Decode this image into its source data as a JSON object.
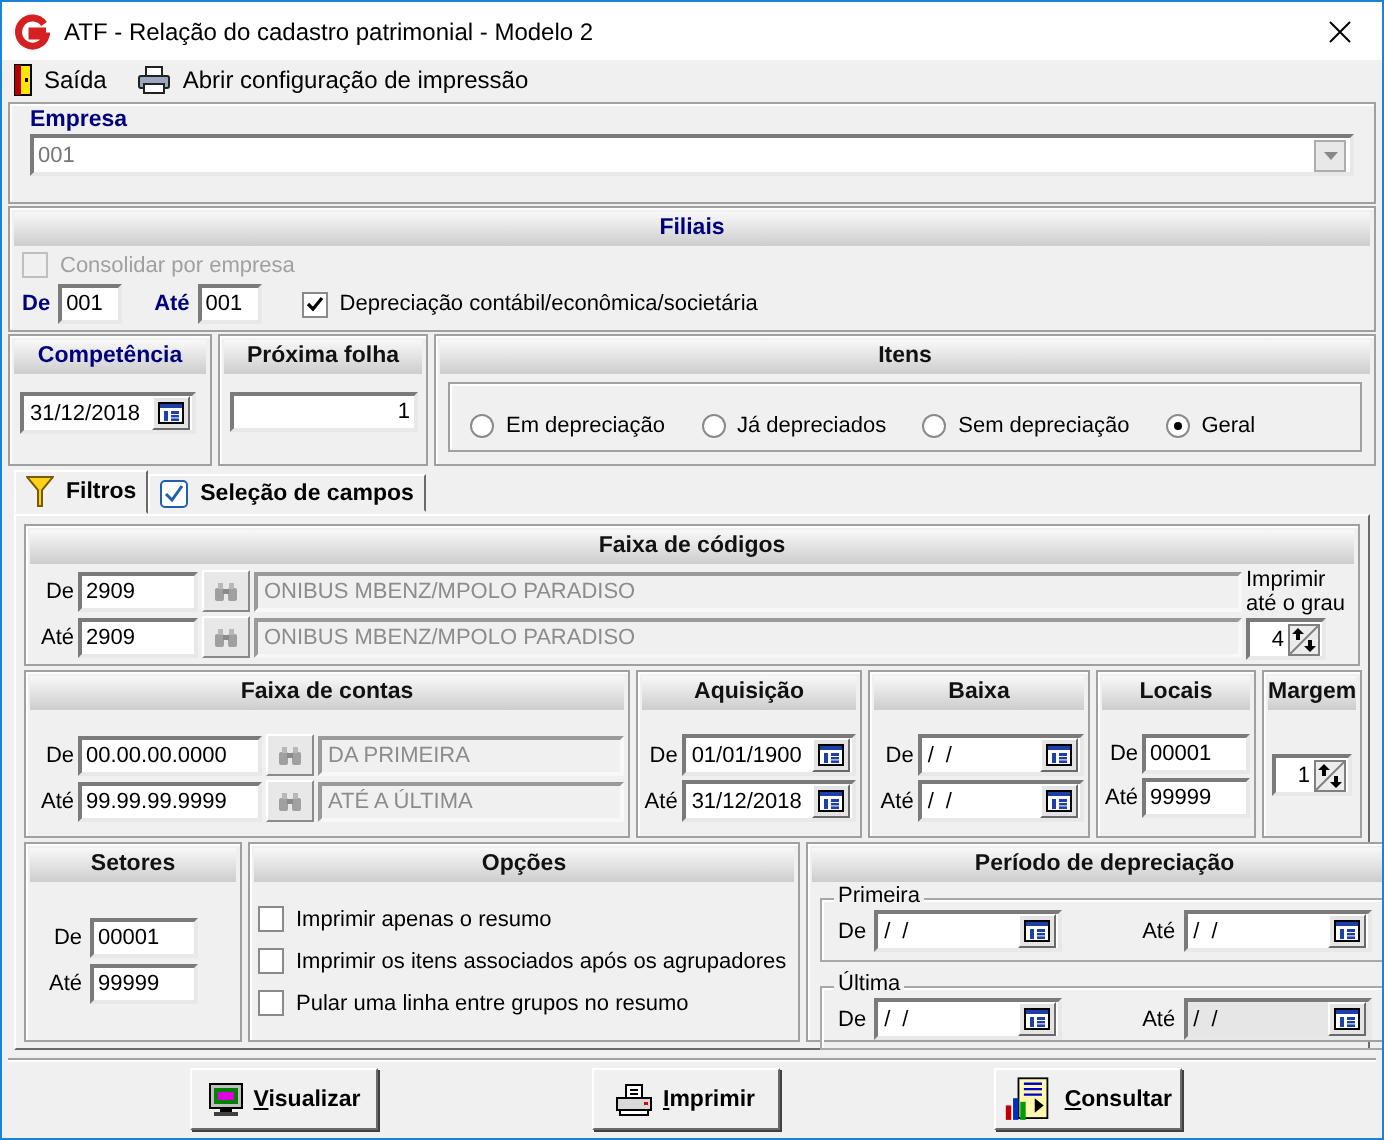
{
  "window": {
    "title": "ATF - Relação do cadastro patrimonial - Modelo 2"
  },
  "menu": [
    {
      "kind": "exit",
      "label": "Saída"
    },
    {
      "kind": "print",
      "label": "Abrir configuração de impressão"
    }
  ],
  "empresa": {
    "title": "Empresa",
    "value": "001"
  },
  "filiais": {
    "title": "Filiais",
    "accent": true,
    "consolidar": {
      "label": "Consolidar por empresa",
      "checked": false,
      "disabled": true
    },
    "de_label": "De",
    "de": "001",
    "ate_label": "Até",
    "ate": "001",
    "depreciacao": {
      "label": "Depreciação contábil/econômica/societária",
      "checked": true,
      "disabled": false
    }
  },
  "competencia": {
    "title": "Competência",
    "accent": true,
    "value": "31/12/2018"
  },
  "proxima_folha": {
    "title": "Próxima folha",
    "accent": false,
    "value": "1"
  },
  "itens": {
    "title": "Itens",
    "accent": false,
    "options": [
      {
        "label": "Em depreciação",
        "selected": false
      },
      {
        "label": "Já depreciados",
        "selected": false
      },
      {
        "label": "Sem depreciação",
        "selected": false
      },
      {
        "label": "Geral",
        "selected": true
      }
    ]
  },
  "tabs": [
    {
      "kind": "filter",
      "label": "Filtros",
      "selected": true
    },
    {
      "kind": "check",
      "label": "Seleção de campos",
      "selected": false
    }
  ],
  "faixa_codigos": {
    "title": "Faixa de códigos",
    "accent": false,
    "rows": [
      {
        "label": "De",
        "code": "2909",
        "description": "ONIBUS MBENZ/MPOLO PARADISO"
      },
      {
        "label": "Até",
        "code": "2909",
        "description": "ONIBUS MBENZ/MPOLO PARADISO"
      }
    ],
    "grau_label": "Imprimir até o grau",
    "grau": "4"
  },
  "faixa_contas": {
    "title": "Faixa de contas",
    "accent": false,
    "rows": [
      {
        "label": "De",
        "code": "00.00.00.0000",
        "description": "DA PRIMEIRA"
      },
      {
        "label": "Até",
        "code": "99.99.99.9999",
        "description": "ATÉ A ÚLTIMA"
      }
    ]
  },
  "aquisicao": {
    "title": "Aquisição",
    "accent": false,
    "rows": [
      {
        "label": "De",
        "value": "01/01/1900"
      },
      {
        "label": "Até",
        "value": "31/12/2018"
      }
    ]
  },
  "baixa": {
    "title": "Baixa",
    "accent": false,
    "rows": [
      {
        "label": "De",
        "value": "/ /"
      },
      {
        "label": "Até",
        "value": "/ /"
      }
    ]
  },
  "locais": {
    "title": "Locais",
    "accent": false,
    "rows": [
      {
        "label": "De",
        "value": "00001"
      },
      {
        "label": "Até",
        "value": "99999"
      }
    ]
  },
  "margem": {
    "title": "Margem",
    "accent": false,
    "value": "1"
  },
  "setores": {
    "title": "Setores",
    "accent": false,
    "rows": [
      {
        "label": "De",
        "value": "00001"
      },
      {
        "label": "Até",
        "value": "99999"
      }
    ]
  },
  "opcoes": {
    "title": "Opções",
    "accent": false,
    "items": [
      {
        "label": "Imprimir apenas o resumo",
        "checked": false
      },
      {
        "label": "Imprimir os itens associados após os agrupadores",
        "checked": false
      },
      {
        "label": "Pular uma linha entre grupos no resumo",
        "checked": false
      }
    ]
  },
  "periodo": {
    "title": "Período de depreciação",
    "accent": false,
    "groups": [
      {
        "title": "Primeira",
        "fields": [
          {
            "label": "De",
            "value": "/ /",
            "disabled": false
          },
          {
            "label": "Até",
            "value": "/ /",
            "disabled": false
          }
        ]
      },
      {
        "title": "Última",
        "fields": [
          {
            "label": "De",
            "value": "/ /",
            "disabled": false
          },
          {
            "label": "Até",
            "value": "/ /",
            "disabled": true
          }
        ]
      }
    ]
  },
  "buttons": [
    {
      "kind": "preview",
      "label": "Visualizar"
    },
    {
      "kind": "print",
      "label": "Imprimir"
    },
    {
      "kind": "query",
      "label": "Consultar"
    }
  ]
}
